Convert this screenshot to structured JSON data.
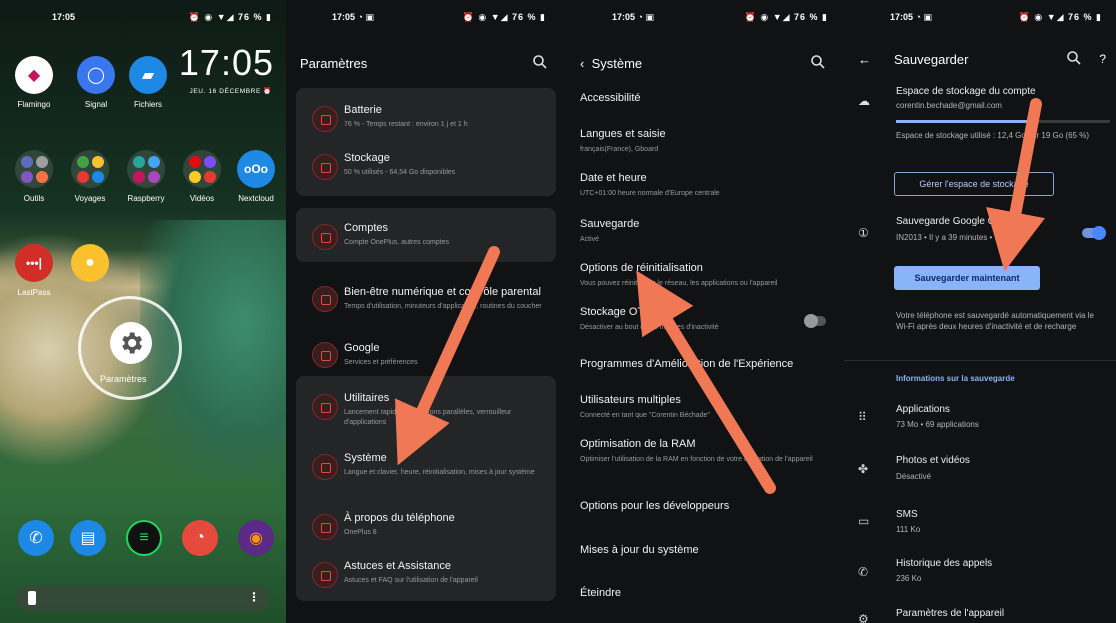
{
  "statusbar": {
    "time": "17:05",
    "battery": "76 %"
  },
  "home": {
    "clock": "17:05",
    "date": "JEU. 16 DÉCEMBRE",
    "apps_row1": [
      "Flamingo",
      "Signal",
      "Fichiers"
    ],
    "apps_row2": [
      "Outils",
      "Voyages",
      "Raspberry",
      "Vidéos",
      "Nextcloud"
    ],
    "apps_row3": [
      "LastPass",
      ""
    ],
    "settings_label": "Paramètres"
  },
  "settings": {
    "title": "Paramètres",
    "items": [
      {
        "title": "Batterie",
        "subtitle": "76 % - Temps restant : environ 1 j et 1 h"
      },
      {
        "title": "Stockage",
        "subtitle": "50 % utilisés - 64,54 Go disponibles"
      },
      {
        "title": "Comptes",
        "subtitle": "Compte OnePlus, autres comptes"
      },
      {
        "title": "Bien-être numérique et contrôle parental",
        "subtitle": "Temps d'utilisation, minuteurs d'application, routines du coucher"
      },
      {
        "title": "Google",
        "subtitle": "Services et préférences"
      },
      {
        "title": "Utilitaires",
        "subtitle": "Lancement rapide, applications parallèles, verrouilleur d'applications"
      },
      {
        "title": "Système",
        "subtitle": "Langue et clavier, heure, réinitialisation, mises à jour système"
      },
      {
        "title": "À propos du téléphone",
        "subtitle": "OnePlus 8"
      },
      {
        "title": "Astuces et Assistance",
        "subtitle": "Astuces et FAQ sur l'utilisation de l'appareil"
      }
    ]
  },
  "system": {
    "title": "Système",
    "items": [
      {
        "title": "Accessibilité",
        "subtitle": ""
      },
      {
        "title": "Langues et saisie",
        "subtitle": "français(France), Gboard"
      },
      {
        "title": "Date et heure",
        "subtitle": "UTC+01:00 heure normale d'Europe centrale"
      },
      {
        "title": "Sauvegarde",
        "subtitle": "Activé"
      },
      {
        "title": "Options de réinitialisation",
        "subtitle": "Vous pouvez réinitialiser le réseau, les applications ou l'appareil"
      },
      {
        "title": "Stockage OTG",
        "subtitle": "Désactiver au bout de 10 minutes d'inactivité"
      },
      {
        "title": "Programmes d'Amélioration de l'Expérience",
        "subtitle": ""
      },
      {
        "title": "Utilisateurs multiples",
        "subtitle": "Connecté en tant que \"Corentin Béchade\""
      },
      {
        "title": "Optimisation de la RAM",
        "subtitle": "Optimiser l'utilisation de la RAM en fonction de votre utilisation de l'appareil"
      },
      {
        "title": "Options pour les développeurs",
        "subtitle": ""
      },
      {
        "title": "Mises à jour du système",
        "subtitle": ""
      },
      {
        "title": "Éteindre",
        "subtitle": ""
      }
    ]
  },
  "backup": {
    "title": "Sauvegarder",
    "account_title": "Espace de stockage du compte",
    "account_email": "corentin.bechade@gmail.com",
    "storage_used": "Espace de stockage utilisé : 12,4 Go sur 19 Go (65 %)",
    "manage_button": "Gérer l'espace de stockage",
    "google_backup_title": "Sauvegarde Google One",
    "google_backup_subtitle": "IN2013 • Il y a 39 minutes • 16:25",
    "backup_now_button": "Sauvegarder maintenant",
    "info_text": "Votre téléphone est sauvegardé automatiquement via le Wi-Fi après deux heures d'inactivité et de recharge",
    "section_title": "Informations sur la sauvegarde",
    "details": [
      {
        "title": "Applications",
        "subtitle": "73 Mo • 69 applications"
      },
      {
        "title": "Photos et vidéos",
        "subtitle": "Désactivé"
      },
      {
        "title": "SMS",
        "subtitle": "111 Ko"
      },
      {
        "title": "Historique des appels",
        "subtitle": "236 Ko"
      },
      {
        "title": "Paramètres de l'appareil",
        "subtitle": ""
      }
    ]
  },
  "colors": {
    "accent_red": "#e24b3b",
    "arrow": "#f07854",
    "blue": "#8ab4f8"
  }
}
